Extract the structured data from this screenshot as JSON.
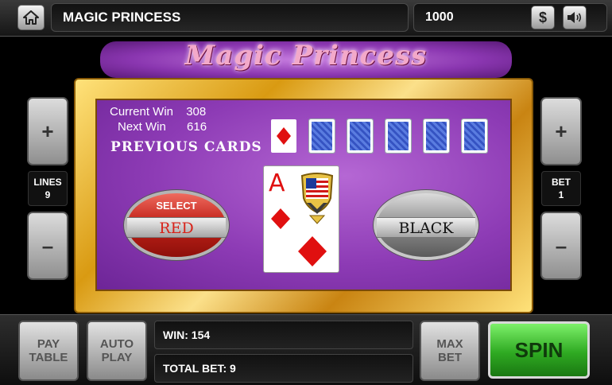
{
  "header": {
    "title": "MAGIC PRINCESS",
    "credits": "1000",
    "dollar_symbol": "$",
    "icons": {
      "home": "home-icon",
      "sound": "speaker-icon"
    }
  },
  "logo": {
    "text": "Magic Princess"
  },
  "lines": {
    "label": "LINES",
    "value": "9",
    "plus": "+",
    "minus": "–"
  },
  "bet": {
    "label": "BET",
    "value": "1",
    "plus": "+",
    "minus": "–"
  },
  "gamble": {
    "current_win_label": "Current Win",
    "current_win_value": "308",
    "next_win_label": "Next Win",
    "next_win_value": "616",
    "previous_cards_label": "PREVIOUS CARDS",
    "previous_cards": [
      {
        "face_up": true,
        "suit": "diamond"
      },
      {
        "face_up": false
      },
      {
        "face_up": false
      },
      {
        "face_up": false
      },
      {
        "face_up": false
      },
      {
        "face_up": false
      }
    ],
    "card": {
      "rank": "A",
      "suit": "diamond"
    },
    "select_label": "SELECT",
    "red_label": "RED",
    "black_label": "BLACK"
  },
  "footer": {
    "paytable_label": "PAY\nTABLE",
    "autoplay_label": "AUTO\nPLAY",
    "win_label": "WIN:",
    "win_value": "154",
    "total_bet_label": "TOTAL BET:",
    "total_bet_value": "9",
    "maxbet_label": "MAX\nBET",
    "spin_label": "SPIN"
  },
  "colors": {
    "accent_red": "#d8231a",
    "spin_green": "#35b526",
    "felt_purple": "#8d3bb5",
    "frame_gold": "#e3a91f"
  }
}
